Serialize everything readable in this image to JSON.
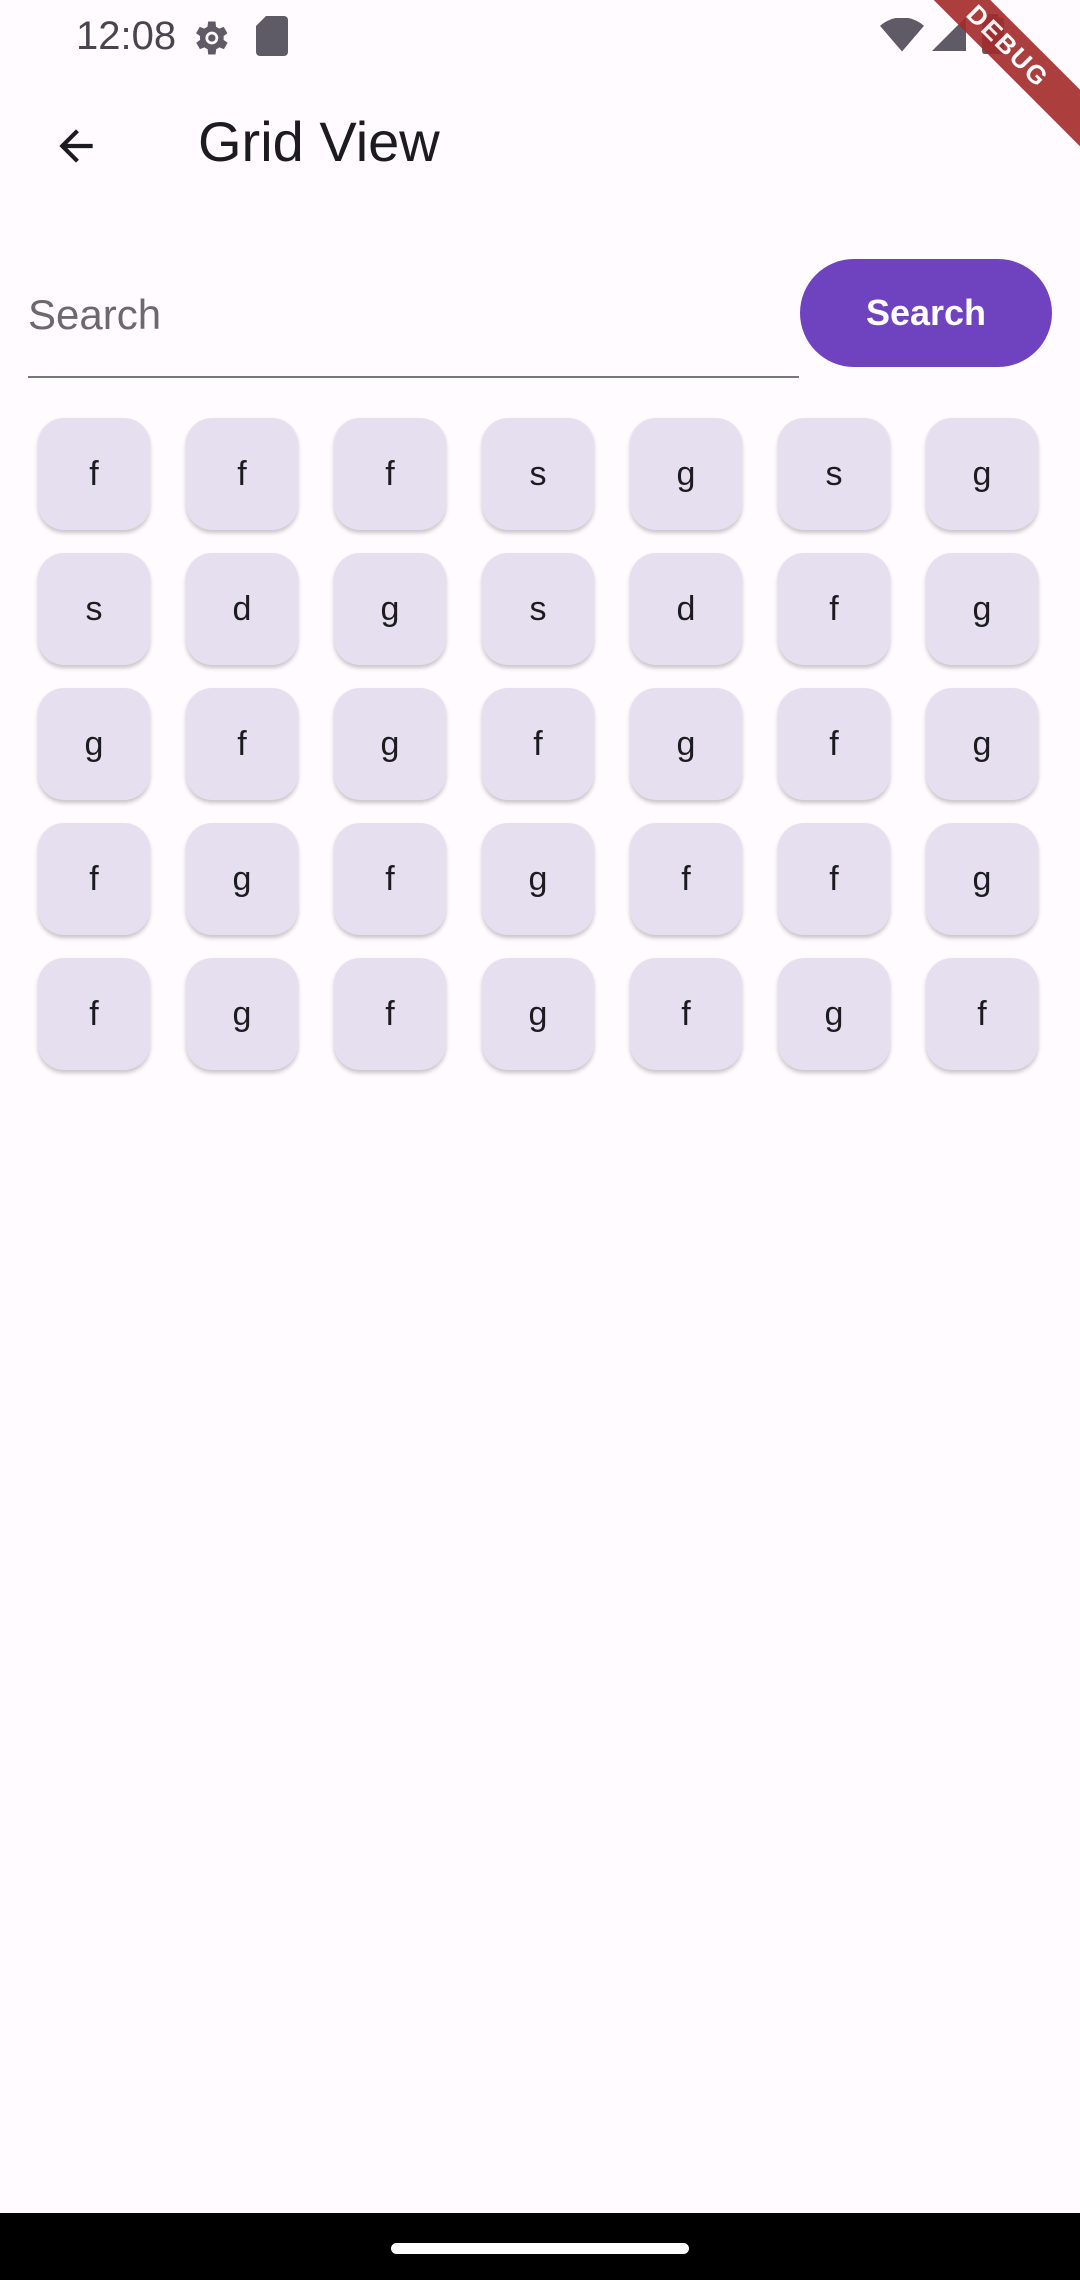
{
  "status_bar": {
    "time": "12:08",
    "icons": [
      "settings-gear-icon",
      "sd-card-icon",
      "wifi-icon",
      "cell-signal-icon",
      "battery-icon"
    ]
  },
  "debug_banner": "DEBUG",
  "app_bar": {
    "title": "Grid View",
    "back_icon": "arrow-back-icon"
  },
  "search": {
    "placeholder": "Search",
    "value": "",
    "button_label": "Search"
  },
  "grid": {
    "columns": 7,
    "items": [
      "f",
      "f",
      "f",
      "s",
      "g",
      "s",
      "g",
      "s",
      "d",
      "g",
      "s",
      "d",
      "f",
      "g",
      "g",
      "f",
      "g",
      "f",
      "g",
      "f",
      "g",
      "f",
      "g",
      "f",
      "g",
      "f",
      "f",
      "g",
      "f",
      "g",
      "f",
      "g",
      "f",
      "g",
      "f"
    ]
  },
  "colors": {
    "background": "#fffbfe",
    "accent": "#6f43c0",
    "tile": "#e5dff0",
    "debug_ribbon": "#a52a2a"
  }
}
